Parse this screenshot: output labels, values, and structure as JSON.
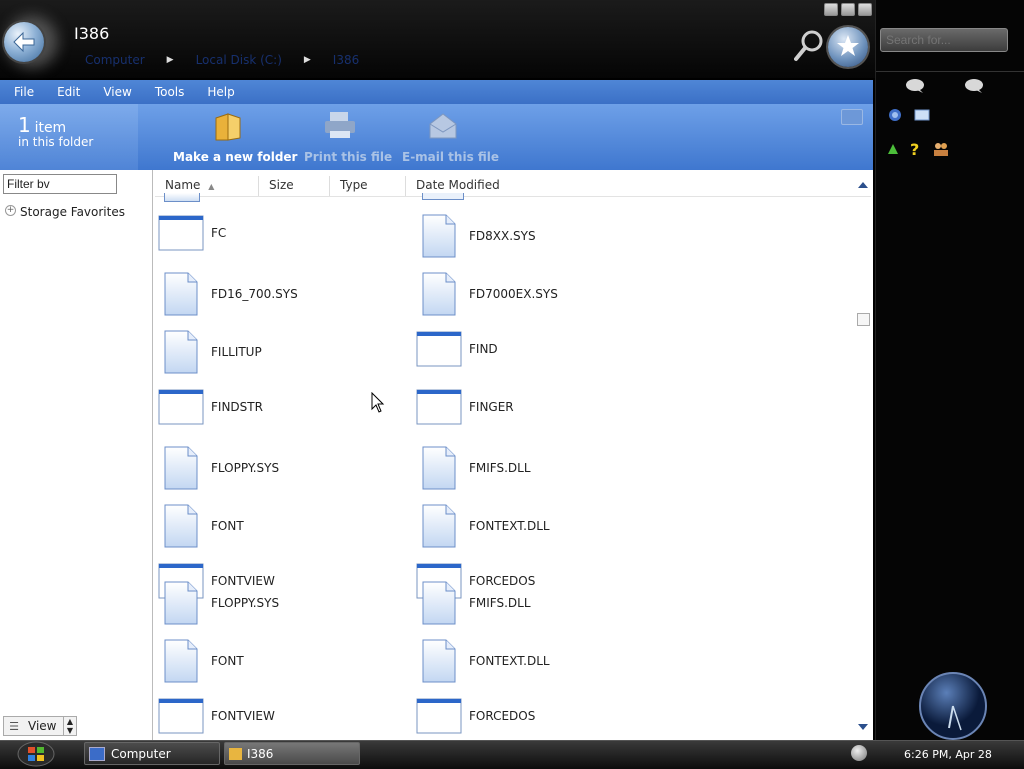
{
  "window": {
    "title": "I386",
    "breadcrumb": [
      "Computer",
      "Local Disk (C:)",
      "I386"
    ],
    "search_placeholder": "Search for..."
  },
  "menu": [
    "File",
    "Edit",
    "View",
    "Tools",
    "Help"
  ],
  "band": {
    "count": "1",
    "count_label": "item",
    "count_sub": "in this folder",
    "commands": {
      "new_folder": "Make a new folder",
      "print": "Print this file",
      "email": "E-mail this file"
    }
  },
  "left_pane": {
    "filter_value": "Filter bv",
    "favorites_label": "Storage Favorites",
    "view_label": "View"
  },
  "columns": [
    "Name",
    "Size",
    "Type",
    "Date Modified"
  ],
  "files": [
    {
      "name": "FC",
      "icon": "window-icon"
    },
    {
      "name": "FD8XX.SYS",
      "icon": "document-icon"
    },
    {
      "name": "FD16_700.SYS",
      "icon": "document-icon"
    },
    {
      "name": "FD7000EX.SYS",
      "icon": "document-icon"
    },
    {
      "name": "FILLITUP",
      "icon": "document-icon"
    },
    {
      "name": "FIND",
      "icon": "window-icon"
    },
    {
      "name": "FINDSTR",
      "icon": "window-icon"
    },
    {
      "name": "FINGER",
      "icon": "window-icon"
    },
    {
      "name": "FLOPPY.SYS",
      "icon": "document-icon"
    },
    {
      "name": "FMIFS.DLL",
      "icon": "document-icon"
    },
    {
      "name": "FONT",
      "icon": "document-icon"
    },
    {
      "name": "FONTEXT.DLL",
      "icon": "document-icon"
    },
    {
      "name": "FONTVIEW",
      "icon": "window-icon"
    },
    {
      "name": "FORCEDOS",
      "icon": "window-icon"
    }
  ],
  "files_repeat": [
    {
      "name": "FLOPPY.SYS",
      "icon": "document-icon"
    },
    {
      "name": "FMIFS.DLL",
      "icon": "document-icon"
    },
    {
      "name": "FONT",
      "icon": "document-icon"
    },
    {
      "name": "FONTEXT.DLL",
      "icon": "document-icon"
    },
    {
      "name": "FONTVIEW",
      "icon": "window-icon"
    },
    {
      "name": "FORCEDOS",
      "icon": "window-icon"
    }
  ],
  "taskbar": {
    "tasks": [
      "Computer",
      "I386"
    ],
    "clock": "6:26 PM, Apr 28"
  },
  "colors": {
    "menu_blue": "#4a80d2",
    "band_blue": "#5a8fe0",
    "dark_bg": "#050505"
  }
}
